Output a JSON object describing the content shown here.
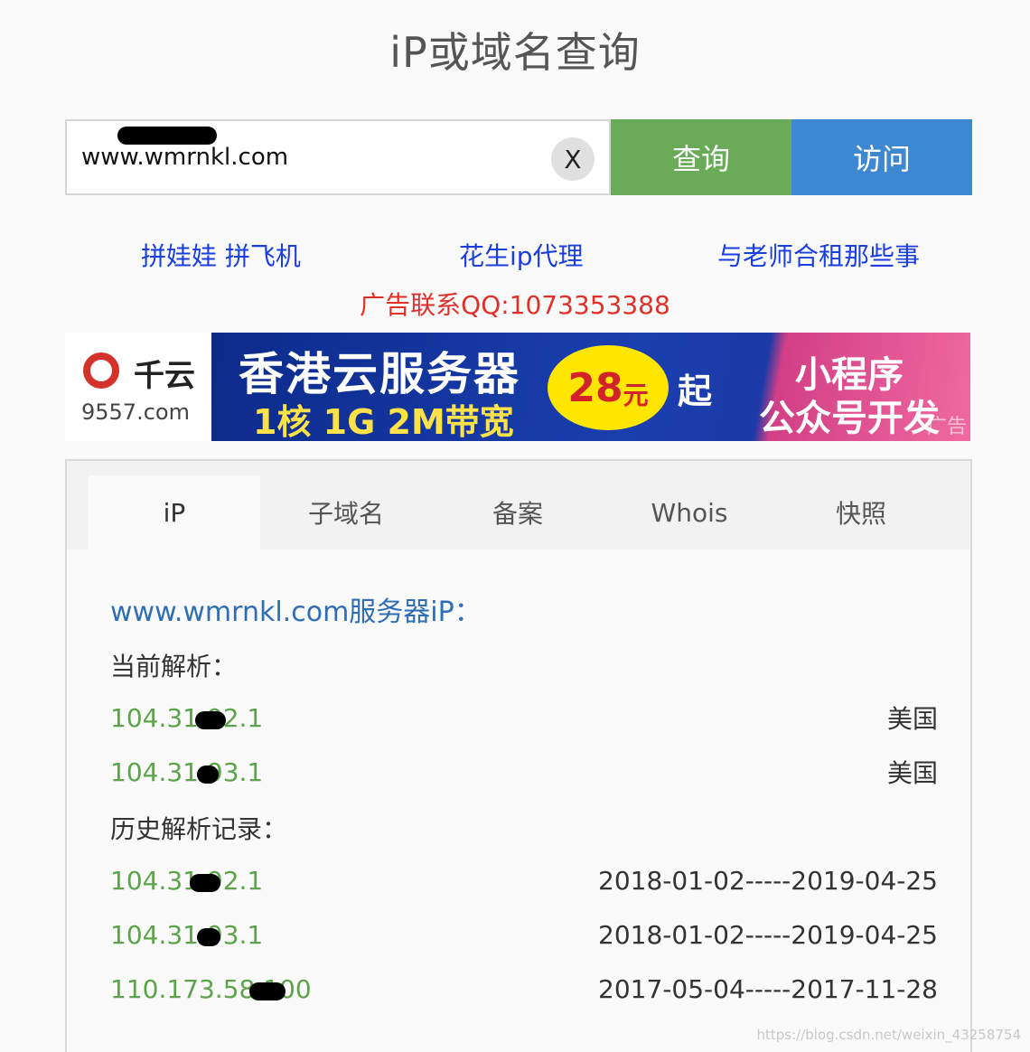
{
  "page": {
    "title": "iP或域名查询"
  },
  "search": {
    "value": "www.wmrnkl.com",
    "clear_label": "X",
    "query_button": "查询",
    "visit_button": "访问"
  },
  "links": [
    {
      "label": "拼娃娃 拼飞机"
    },
    {
      "label": "花生ip代理"
    },
    {
      "label": "与老师合租那些事"
    }
  ],
  "ad_contact": "广告联系QQ:1073353388",
  "banner": {
    "logo_cn": "千云",
    "logo_domain": "9557.com",
    "line1": "香港云服务器",
    "line2": "1核 1G 2M带宽",
    "price_num": "28",
    "price_unit": "元",
    "price_suffix": "起",
    "right_line1": "小程序",
    "right_line2": "公众号开发",
    "ad_tag": "广告",
    "colors": {
      "primary": "#1a3fae",
      "accent": "#ffe600",
      "pink": "#f06aa0"
    }
  },
  "tabs": [
    {
      "label": "iP",
      "active": true
    },
    {
      "label": "子域名",
      "active": false
    },
    {
      "label": "备案",
      "active": false
    },
    {
      "label": "Whois",
      "active": false
    },
    {
      "label": "快照",
      "active": false
    }
  ],
  "result": {
    "title": "www.wmrnkl.com服务器iP：",
    "current_label": "当前解析：",
    "current": [
      {
        "ip": "104.31.92.1",
        "location": "美国"
      },
      {
        "ip": "104.31.93.1",
        "location": "美国"
      }
    ],
    "history_label": "历史解析记录：",
    "history": [
      {
        "ip": "104.31.92.1",
        "range": "2018-01-02-----2019-04-25"
      },
      {
        "ip": "104.31.93.1",
        "range": "2018-01-02-----2019-04-25"
      },
      {
        "ip": "110.173.58.100",
        "range": "2017-05-04-----2017-11-28"
      }
    ]
  },
  "watermark": "https://blog.csdn.net/weixin_43258754",
  "colors": {
    "query_green": "#6aab5a",
    "visit_blue": "#3e88d1",
    "link_blue": "#1a3ee0",
    "ad_red": "#e0302a",
    "ip_green": "#5da34b",
    "title_blue": "#2f6db4"
  }
}
